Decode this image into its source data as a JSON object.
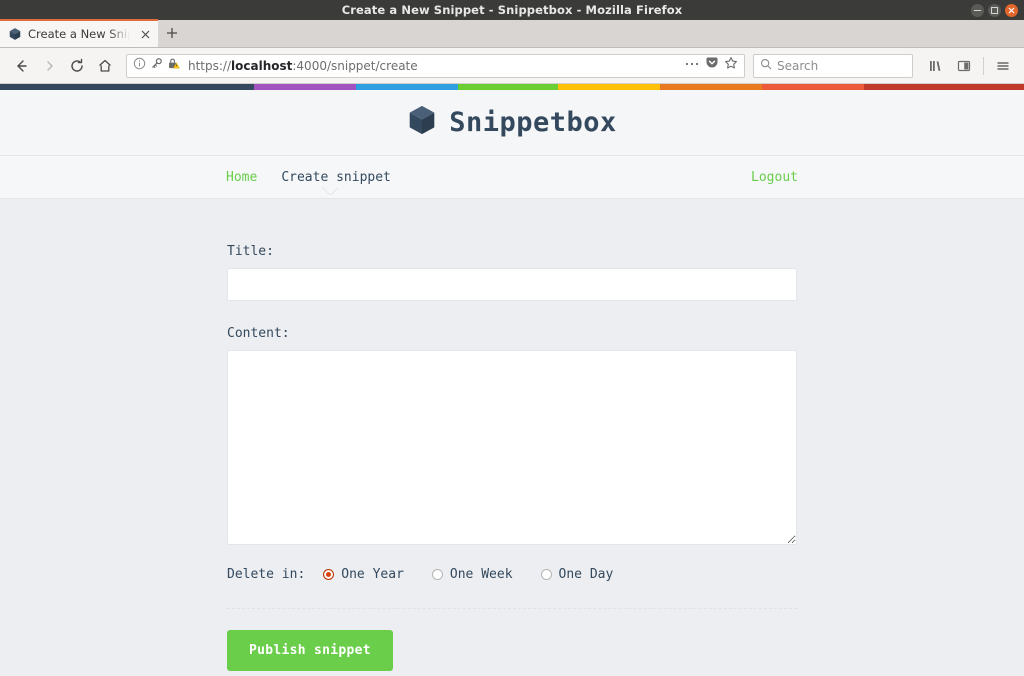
{
  "browser": {
    "window_title": "Create a New Snippet - Snippetbox - Mozilla Firefox",
    "tab": {
      "title": "Create a New Snippe",
      "favicon_name": "snippetbox-box-favicon",
      "close_label": "×",
      "new_tab_label": "+"
    },
    "window_controls": {
      "minimize": "minimize",
      "maximize": "maximize",
      "close": "close"
    },
    "nav": {
      "back": "Back",
      "forward": "Forward",
      "reload": "Reload",
      "home": "Home"
    },
    "url": {
      "scheme": "https://",
      "host": "localhost",
      "rest": ":4000/snippet/create",
      "full": "https://localhost:4000/snippet/create",
      "icons": [
        "info-icon",
        "key-icon",
        "insecure-lock-icon"
      ],
      "actions": [
        "page-actions-ellipsis",
        "pocket-icon",
        "bookmark-star-icon"
      ]
    },
    "search": {
      "placeholder": "Search",
      "icon": "search-icon"
    },
    "toolbar_icons": [
      "library-icon",
      "sidebar-icon",
      "hamburger-menu-icon"
    ]
  },
  "stripe": {
    "colors": [
      "#34495e",
      "#a152c0",
      "#2e9fe0",
      "#6ace33",
      "#ffc107",
      "#e8791f",
      "#ed5a3a",
      "#c0392b"
    ]
  },
  "site": {
    "logo": {
      "text": "Snippetbox",
      "icon": "box-logo-icon"
    },
    "nav": {
      "home": "Home",
      "create": "Create snippet",
      "logout": "Logout"
    }
  },
  "form": {
    "title_label": "Title:",
    "title_value": "",
    "content_label": "Content:",
    "content_value": "",
    "expires_label": "Delete in:",
    "expires_options": [
      {
        "label": "One Year",
        "value": "365",
        "selected": true
      },
      {
        "label": "One Week",
        "value": "7",
        "selected": false
      },
      {
        "label": "One Day",
        "value": "1",
        "selected": false
      }
    ],
    "submit_label": "Publish snippet"
  },
  "colors": {
    "accent_green": "#6ace4b",
    "heading_slate": "#34495e",
    "radio_selected": "#d9430d",
    "page_bg": "#eceef1"
  }
}
